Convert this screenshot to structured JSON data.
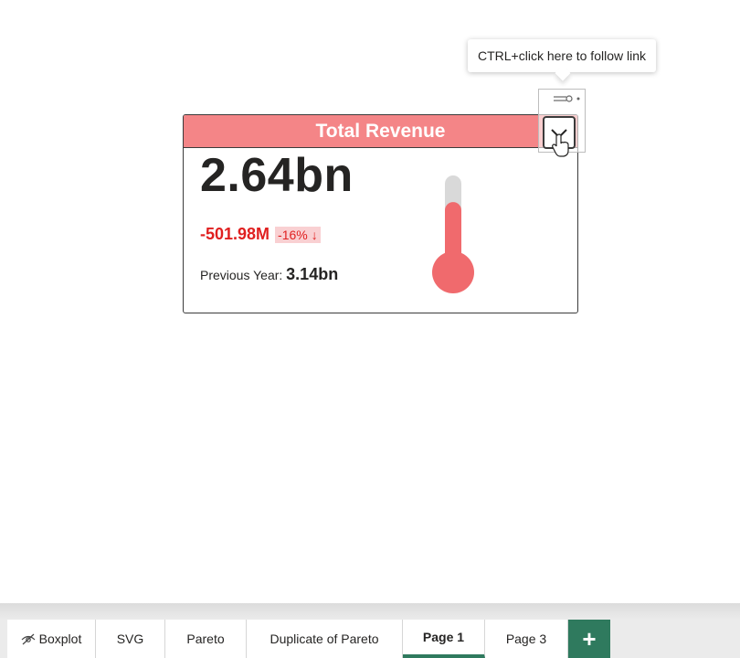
{
  "tooltip": {
    "text": "CTRL+click here to follow link"
  },
  "card": {
    "title": "Total Revenue",
    "value": "2.64bn",
    "variance_value": "-501.98M",
    "variance_pct": "-16%",
    "variance_arrow": "↓",
    "previous_label": "Previous Year: ",
    "previous_value": "3.14bn",
    "thermometer_level": 0.72
  },
  "tabs": [
    {
      "label": "Boxplot",
      "hidden": true
    },
    {
      "label": "SVG"
    },
    {
      "label": "Pareto"
    },
    {
      "label": "Duplicate of Pareto"
    },
    {
      "label": "Page 1",
      "active": true
    },
    {
      "label": "Page 3"
    }
  ],
  "add_tab_label": "+",
  "colors": {
    "title_bg": "#f48587",
    "negative": "#e02020",
    "variance_bg": "#f9d0d2",
    "accent": "#2f7a5e",
    "thermo_fill": "#f06a6d",
    "thermo_track": "#d9d9d9"
  },
  "icons": {
    "dropdown": "chevron-down-icon",
    "cursor": "hand-pointer-icon",
    "hidden": "eye-hidden-icon",
    "more": "more-options-icon"
  }
}
